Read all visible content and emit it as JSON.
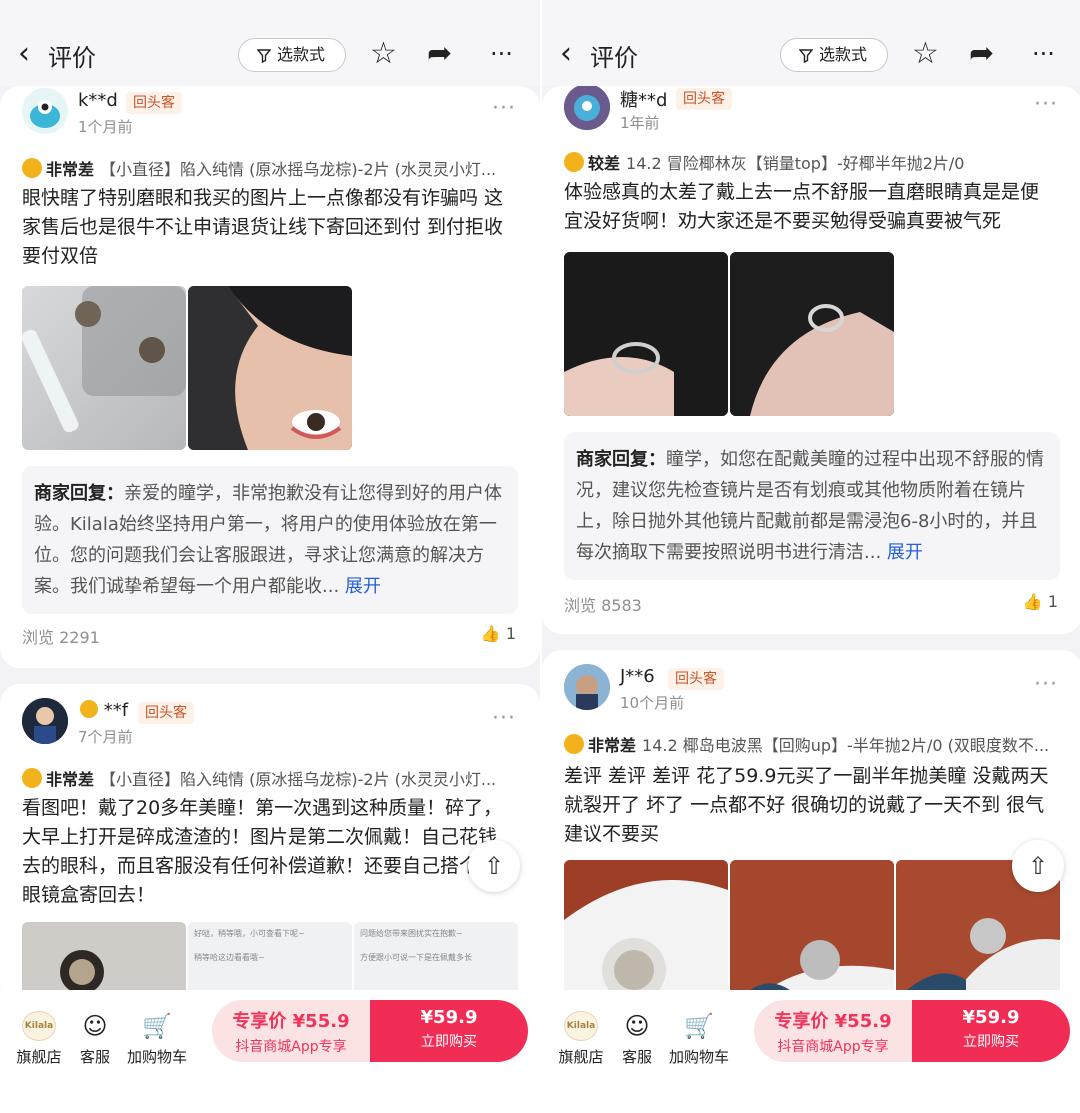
{
  "left": {
    "header": {
      "back_icon": "‹",
      "title": "评价",
      "filter_label": "选款式",
      "filter_icon": "funnel-icon",
      "star_icon": "☆",
      "share_icon": "➦",
      "more_icon": "···"
    },
    "reviews": [
      {
        "username": "k**d",
        "badge": "回头客",
        "time": "1个月前",
        "rating_label": "非常差",
        "variant": "【小直径】陷入纯情 (原冰摇乌龙棕)-2片 (水灵灵小灯...",
        "text": "眼快瞎了特别磨眼和我买的图片上一点像都没有诈骗吗 这家售后也是很牛不让申请退货让线下寄回还到付 到付拒收要付双倍",
        "reply_label": "商家回复：",
        "reply_text": "亲爱的瞳学，非常抱歉没有让您得到好的用户体验。Kilala始终坚持用户第一，将用户的使用体验放在第一位。您的问题我们会让客服跟进，寻求让您满意的解决方案。我们诚挚希望每一个用户都能收...",
        "expand": "展开",
        "views": "浏览 2291",
        "likes": "1"
      },
      {
        "username": "**f",
        "badge": "回头客",
        "time": "7个月前",
        "rating_label": "非常差",
        "variant": "【小直径】陷入纯情 (原冰摇乌龙棕)-2片 (水灵灵小灯...",
        "text": "看图吧！戴了20多年美瞳！第一次遇到这种质量！碎了，大早上打开是碎成渣渣的！图片是第二次佩戴！自己花钱去的眼科，而且客服没有任何补偿道歉！还要自己搭个形眼镜盒寄回去！",
        "chat_lines": [
          "好哒，稍等哦，小可查看下呢~",
          "稍等哈这边看看哦~",
          "问题给您带来困扰实在抱歉~",
          "方便跟小可说一下是在佩戴多长"
        ]
      }
    ],
    "bottom": {
      "store_logo": "Kilala",
      "store": "旗舰店",
      "service": "客服",
      "cart": "加购物车",
      "promo_price": "专享价 ¥55.9",
      "promo_sub": "抖音商城App专享",
      "price": "¥59.9",
      "buy": "立即购买"
    }
  },
  "right": {
    "header": {
      "back_icon": "‹",
      "title": "评价",
      "filter_label": "选款式",
      "filter_icon": "funnel-icon",
      "star_icon": "☆",
      "share_icon": "➦",
      "more_icon": "···"
    },
    "reviews": [
      {
        "username": "糖**d",
        "badge": "回头客",
        "time": "1年前",
        "rating_label": "较差",
        "variant": "14.2 冒险椰林灰【销量top】-好椰半年抛2片/0",
        "text": "体验感真的太差了戴上去一点不舒服一直磨眼睛真是是便宜没好货啊！劝大家还是不要买勉得受骗真要被气死",
        "reply_label": "商家回复：",
        "reply_text": "瞳学，如您在配戴美瞳的过程中出现不舒服的情况，建议您先检查镜片是否有划痕或其他物质附着在镜片上，除日抛外其他镜片配戴前都是需浸泡6-8小时的，并且每次摘取下需要按照说明书进行清洁...",
        "expand": "展开",
        "views": "浏览 8583",
        "likes": "1"
      },
      {
        "username": "J**6",
        "badge": "回头客",
        "time": "10个月前",
        "rating_label": "非常差",
        "variant": "14.2 椰岛电波黑【回购up】-半年抛2片/0 (双眼度数不...",
        "text": "差评 差评 差评 花了59.9元买了一副半年抛美瞳 没戴两天就裂开了 坏了 一点都不好 很确切的说戴了一天不到 很气建议不要买"
      }
    ],
    "bottom": {
      "store_logo": "Kilala",
      "store": "旗舰店",
      "service": "客服",
      "cart": "加购物车",
      "promo_price": "专享价 ¥55.9",
      "promo_sub": "抖音商城App专享",
      "price": "¥59.9",
      "buy": "立即购买"
    }
  },
  "icons": {
    "more": "···",
    "like": "👍",
    "back_to_top": "⇧",
    "service": "☺",
    "cart": "🛒"
  }
}
